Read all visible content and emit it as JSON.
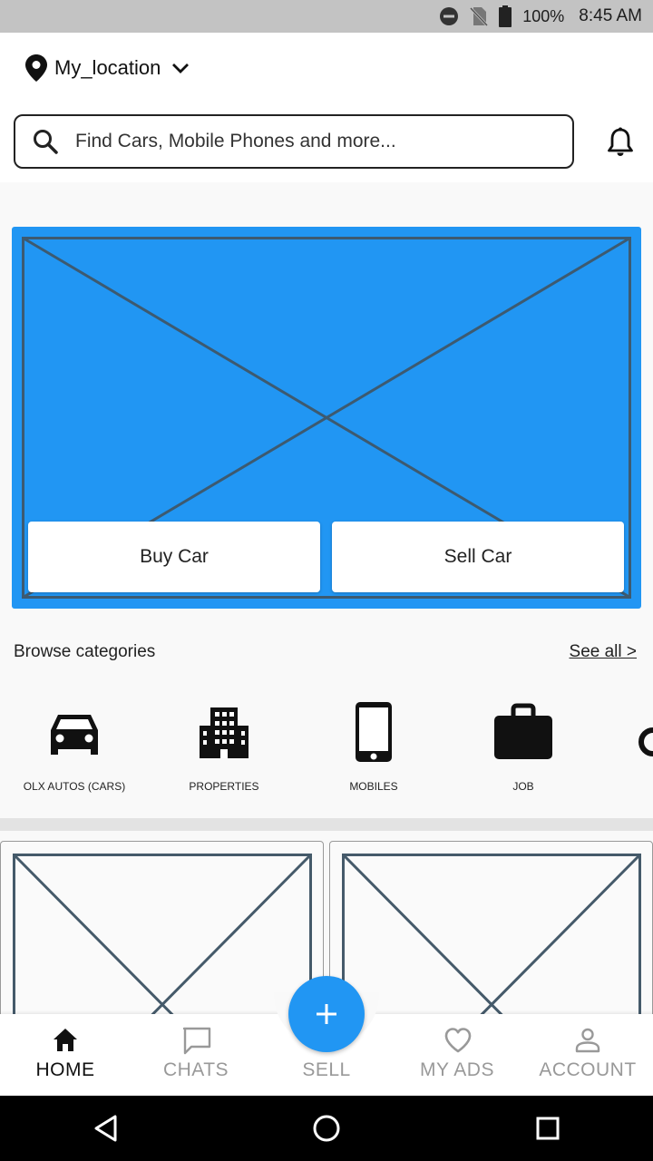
{
  "status_bar": {
    "battery": "100%",
    "time": "8:45 AM",
    "icons": [
      "do-not-disturb-icon",
      "no-sim-icon",
      "battery-icon"
    ]
  },
  "header": {
    "location": "My_location",
    "search_placeholder": "Find Cars, Mobile Phones and more...",
    "icons": [
      "location-pin-icon",
      "chevron-down-icon",
      "search-icon",
      "bell-icon"
    ]
  },
  "banner": {
    "buy_label": "Buy Car",
    "sell_label": "Sell Car",
    "color": "#2196f3"
  },
  "categories": {
    "title": "Browse categories",
    "see_all": "See all >",
    "items": [
      {
        "label": "OLX AUTOS (CARS)",
        "icon": "car-icon"
      },
      {
        "label": "PROPERTIES",
        "icon": "building-icon"
      },
      {
        "label": "MOBILES",
        "icon": "mobile-phone-icon"
      },
      {
        "label": "JOB",
        "icon": "briefcase-icon"
      }
    ]
  },
  "bottom_nav": {
    "items": [
      {
        "label": "HOME",
        "icon": "home-icon",
        "active": true
      },
      {
        "label": "CHATS",
        "icon": "chat-icon",
        "active": false
      },
      {
        "label": "SELL",
        "icon": "plus-icon",
        "active": false
      },
      {
        "label": "MY ADS",
        "icon": "heart-icon",
        "active": false
      },
      {
        "label": "ACCOUNT",
        "icon": "person-icon",
        "active": false
      }
    ],
    "accent": "#2196f3"
  },
  "system_nav": [
    "back-icon",
    "home-circle-icon",
    "recents-icon"
  ]
}
